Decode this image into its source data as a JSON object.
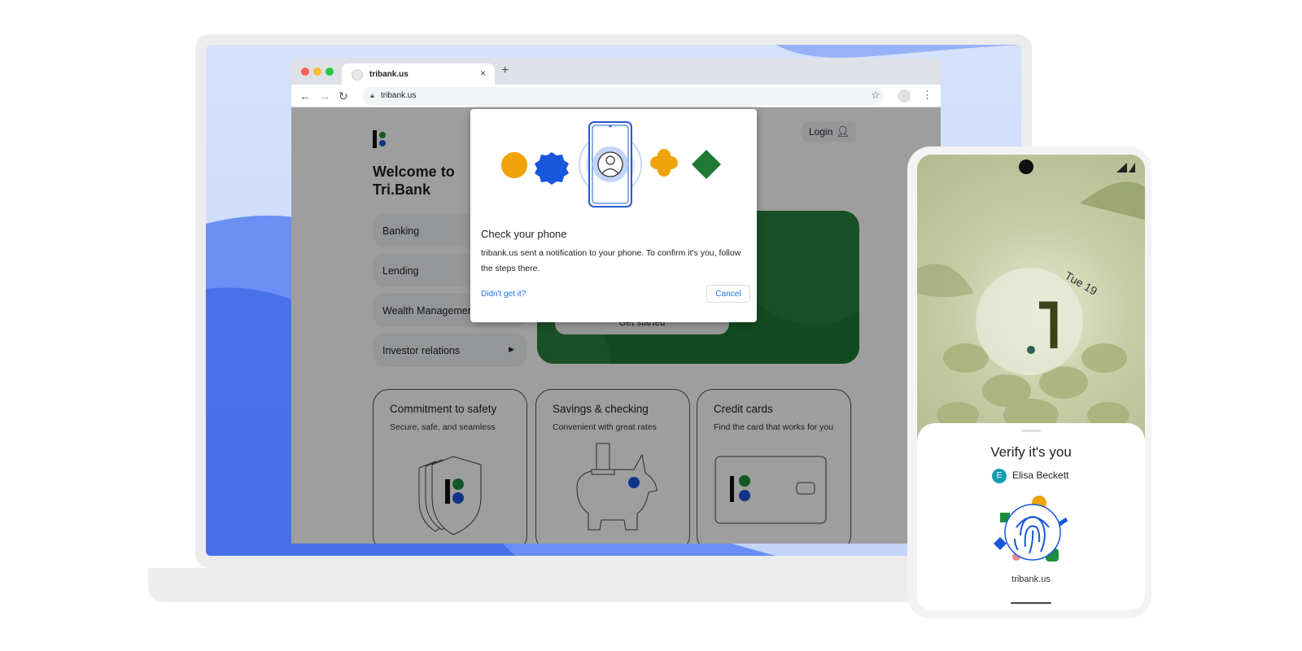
{
  "browser": {
    "tab_title": "tribank.us",
    "tab_close": "×",
    "new_tab": "+",
    "url": "tribank.us"
  },
  "site": {
    "welcome_line1": "Welcome to",
    "welcome_line2": "Tri.Bank",
    "login_label": "Login",
    "menu": [
      "Banking",
      "Lending",
      "Wealth Management",
      "Investor relations"
    ],
    "hero_button": "Get started",
    "cards": [
      {
        "title": "Commitment to safety",
        "subtitle": "Secure, safe, and seamless"
      },
      {
        "title": "Savings & checking",
        "subtitle": "Convenient with great rates"
      },
      {
        "title": "Credit cards",
        "subtitle": "Find the card that works for you"
      }
    ]
  },
  "dialog": {
    "title": "Check your phone",
    "body": "tribank.us sent a notification to your phone. To confirm it's you, follow the steps there.",
    "link": "Didn't get it?",
    "cancel": "Cancel"
  },
  "phone": {
    "date": "Tue 19",
    "verify_title": "Verify it's you",
    "account_initial": "E",
    "account_name": "Elisa Beckett",
    "site": "tribank.us"
  },
  "colors": {
    "brand_green": "#1e7a34",
    "brand_blue": "#1a56db",
    "accent_yellow": "#f0a30a",
    "link_blue": "#1a73e8"
  }
}
